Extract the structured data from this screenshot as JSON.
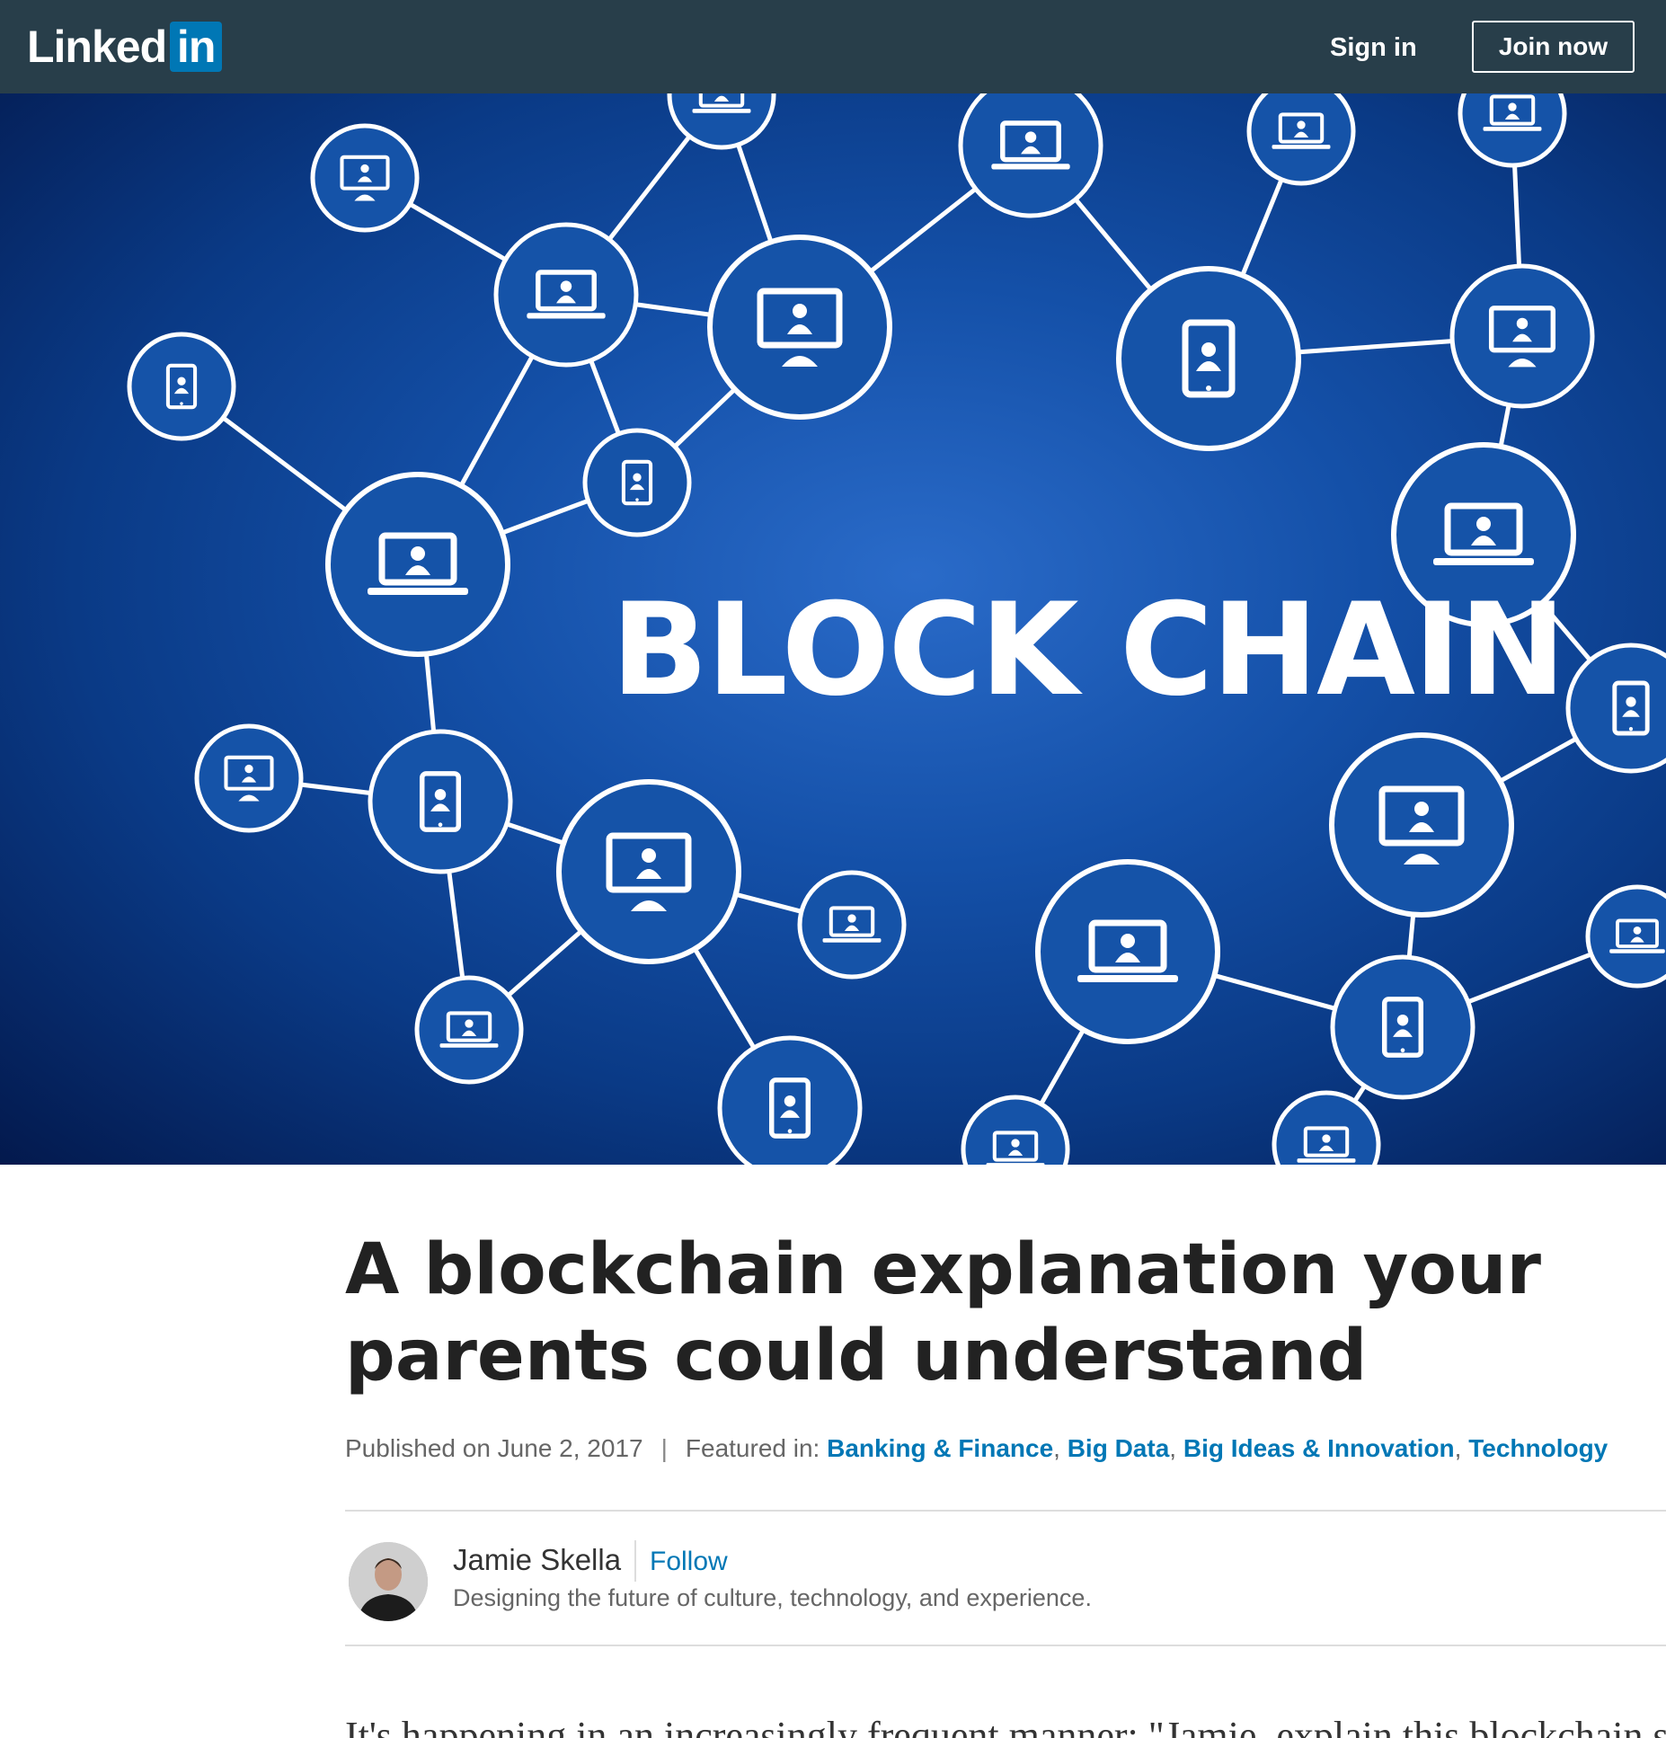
{
  "nav": {
    "logo_text": "Linked",
    "logo_box_text": "in",
    "signin_label": "Sign in",
    "join_label": "Join now",
    "bg_color": "#283e4a",
    "brand_color": "#0077b5"
  },
  "hero": {
    "title": "BLOCK CHAIN",
    "device_icons": [
      "laptop-icon",
      "monitor-icon",
      "tablet-icon"
    ]
  },
  "article": {
    "title": "A blockchain explanation your parents could understand",
    "published": "Published on June 2, 2017",
    "separator": "|",
    "featured_label": "Featured in:",
    "tags": [
      "Banking & Finance",
      "Big Data",
      "Big Ideas & Innovation",
      "Technology"
    ],
    "tag_sep": ",",
    "body_start": "It's happening in an increasingly frequent manner: \"Jamie, explain this blockchain stuff"
  },
  "author": {
    "name": "Jamie Skella",
    "follow_label": "Follow",
    "headline": "Designing the future of culture, technology, and experience."
  }
}
